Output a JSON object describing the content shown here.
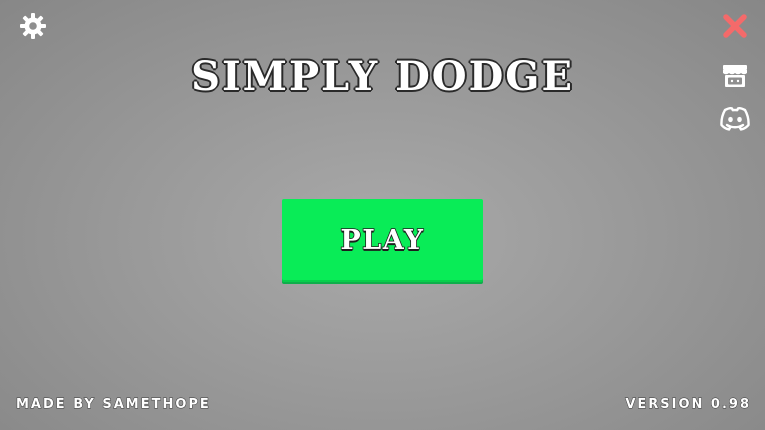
{
  "title": "SIMPLY DODGE",
  "play_button": {
    "label": "PLAY"
  },
  "footer": {
    "credit": "MADE BY SAMETHOPE",
    "version": "VERSION 0.98"
  },
  "icons": {
    "settings": "gear-icon",
    "close": "close-icon",
    "store": "store-icon",
    "discord": "discord-icon"
  },
  "colors": {
    "background": "#a0a0a0",
    "play_button": "#09ec57",
    "close_icon": "#f46a6a",
    "text_fill": "#ffffff",
    "text_outline": "#2a2a2a"
  }
}
